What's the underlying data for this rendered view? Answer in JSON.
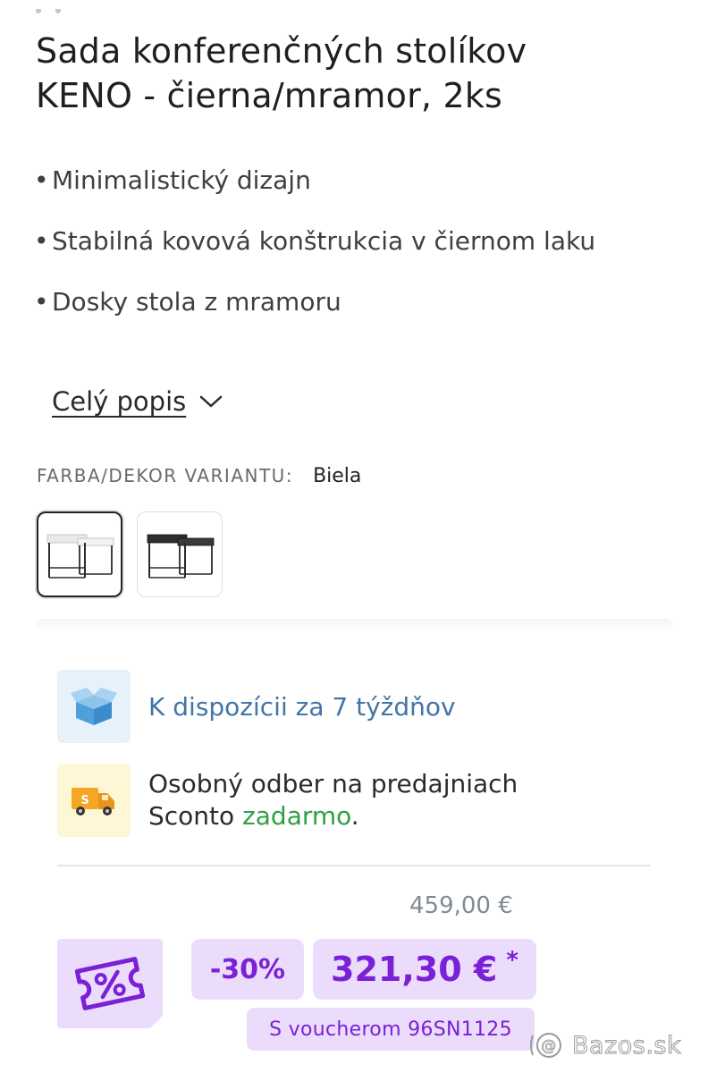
{
  "product": {
    "title_line1": "Sada konferenčných stolíkov",
    "title_line2": "KENO - čierna/mramor, 2ks",
    "features": [
      "Minimalistický dizajn",
      "Stabilná kovová konštrukcia v čiernom laku",
      "Dosky stola z mramoru"
    ],
    "full_description_link": "Celý popis"
  },
  "variant": {
    "label": "FARBA/DEKOR VARIANTU:",
    "value": "Biela",
    "options": [
      {
        "name": "Biela",
        "selected": true
      },
      {
        "name": "Čierna",
        "selected": false
      }
    ]
  },
  "availability": {
    "text": "K dispozícii za 7 týždňov",
    "icon": "box-icon"
  },
  "pickup": {
    "line1": "Osobný odber na predajniach",
    "line2_prefix": "Sconto ",
    "line2_highlight": "zadarmo",
    "line2_suffix": ".",
    "icon": "delivery-truck-icon"
  },
  "pricing": {
    "old_price": "459,00 €",
    "discount": "-30%",
    "new_price": "321,30 €",
    "asterisk": "*",
    "voucher_text": "S voucherom 96SN1125",
    "icon": "percent-ticket-icon"
  },
  "watermark": {
    "text": "Bazos.sk"
  },
  "colors": {
    "accent_purple": "#7a20d6",
    "purple_bg": "#ecdcfb",
    "availability_blue": "#4275a8",
    "free_green": "#2ea043"
  }
}
